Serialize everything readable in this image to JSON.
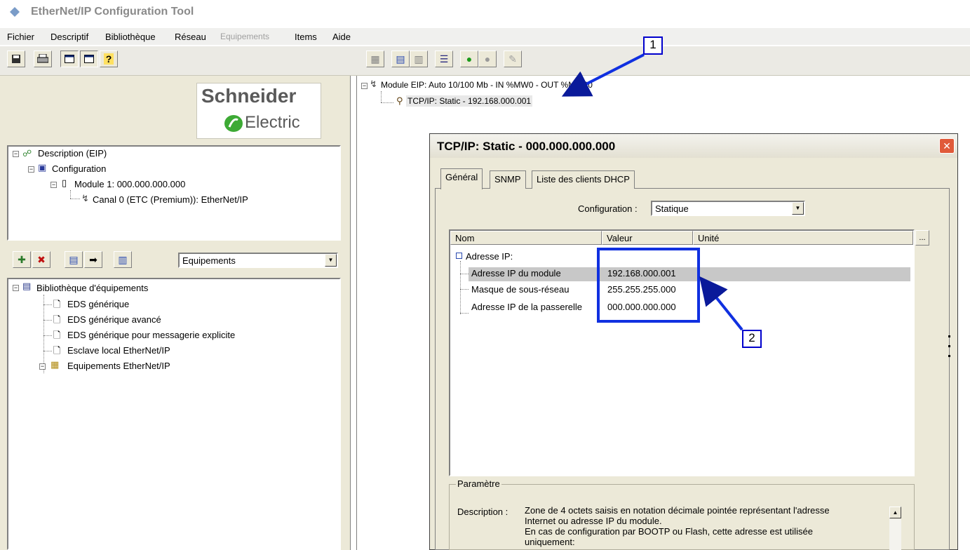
{
  "window": {
    "title": "EtherNet/IP Configuration Tool"
  },
  "menu": {
    "items": [
      {
        "label": "Fichier",
        "enabled": true
      },
      {
        "label": "Descriptif",
        "enabled": true
      },
      {
        "label": "Bibliothèque",
        "enabled": true
      },
      {
        "label": "Réseau",
        "enabled": true
      },
      {
        "label": "Equipements",
        "enabled": false
      },
      {
        "label": "Items",
        "enabled": true
      },
      {
        "label": "Aide",
        "enabled": true
      }
    ]
  },
  "left_toolbar": {
    "icons": [
      "save-icon",
      "print-icon",
      "window-icon",
      "window-icon",
      "help-icon"
    ]
  },
  "right_toolbar": {
    "icons": [
      "delete-icon",
      "properties-icon",
      "config-icon",
      "list-icon",
      "online-icon",
      "offline-icon",
      "tool-icon"
    ]
  },
  "logo": {
    "line1": "Schneider",
    "line2": "Electric"
  },
  "description_tree": {
    "root": "Description (EIP)",
    "config": "Configuration",
    "module": "Module 1:  000.000.000.000",
    "channel": "Canal 0 (ETC (Premium)): EtherNet/IP"
  },
  "library": {
    "filter_value": "Equipements",
    "root": "Bibliothèque d'équipements",
    "items": [
      "EDS générique",
      "EDS générique avancé",
      "EDS générique pour messagerie explicite",
      "Esclave local EtherNet/IP",
      "Equipements EtherNet/IP"
    ]
  },
  "network_tree": {
    "module": "Module EIP: Auto 10/100 Mb - IN %MW0 - OUT %MW30",
    "tcpip": "TCP/IP: Static - 192.168.000.001"
  },
  "dialog": {
    "title": "TCP/IP: Static - 000.000.000.000",
    "close": "✕",
    "tabs": [
      "Général",
      "SNMP",
      "Liste des clients DHCP"
    ],
    "configuration_label": "Configuration :",
    "configuration_value": "Statique",
    "grid_headers": [
      "Nom",
      "Valeur",
      "Unité"
    ],
    "ellipsis": "...",
    "grid_group": "Adresse IP:",
    "rows": [
      {
        "name": "Adresse IP du module",
        "value": "192.168.000.001"
      },
      {
        "name": "Masque de sous-réseau",
        "value": "255.255.255.000"
      },
      {
        "name": "Adresse IP de la passerelle",
        "value": "000.000.000.000"
      }
    ],
    "param_legend": "Paramètre",
    "description_label": "Description :",
    "description_lines": [
      "Zone de 4 octets saisis en notation décimale pointée représentant l'adresse",
      "Internet ou adresse IP du module.",
      "En cas de configuration par BOOTP ou Flash, cette adresse est utilisée",
      "uniquement:"
    ]
  },
  "callouts": [
    "1",
    "2"
  ]
}
